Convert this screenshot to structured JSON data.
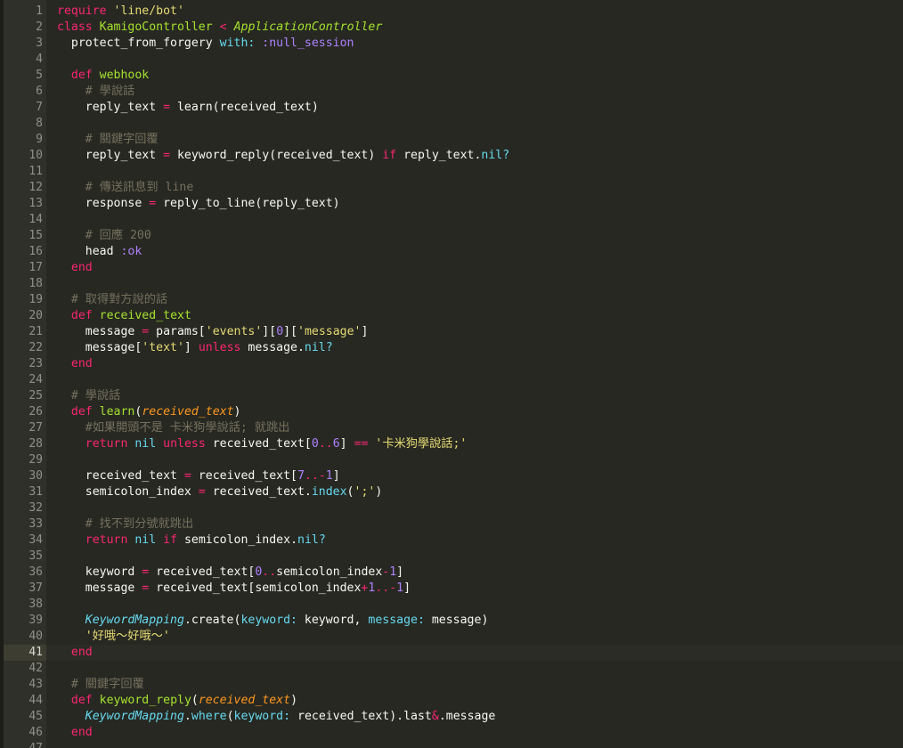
{
  "editor": {
    "active_line": 41,
    "line_numbers": [
      1,
      2,
      3,
      4,
      5,
      6,
      7,
      8,
      9,
      10,
      11,
      12,
      13,
      14,
      15,
      16,
      17,
      18,
      19,
      20,
      21,
      22,
      23,
      24,
      25,
      26,
      27,
      28,
      29,
      30,
      31,
      32,
      33,
      34,
      35,
      36,
      37,
      38,
      39,
      40,
      41,
      42,
      43,
      44,
      45,
      46,
      47
    ],
    "lines": [
      [
        [
          "k",
          "require"
        ],
        [
          "t",
          " "
        ],
        [
          "s",
          "'line/bot'"
        ]
      ],
      [
        [
          "k",
          "class"
        ],
        [
          "t",
          " "
        ],
        [
          "f",
          "KamigoController"
        ],
        [
          "t",
          " "
        ],
        [
          "o",
          "<"
        ],
        [
          "t",
          " "
        ],
        [
          "g",
          "ApplicationController"
        ]
      ],
      [
        [
          "t",
          "  protect_from_forgery "
        ],
        [
          "b",
          "with:"
        ],
        [
          "t",
          " "
        ],
        [
          "y",
          ":null_session"
        ]
      ],
      [],
      [
        [
          "t",
          "  "
        ],
        [
          "k",
          "def"
        ],
        [
          "t",
          " "
        ],
        [
          "f",
          "webhook"
        ]
      ],
      [
        [
          "c",
          "    # 學說話"
        ]
      ],
      [
        [
          "t",
          "    reply_text "
        ],
        [
          "o",
          "="
        ],
        [
          "t",
          " learn(received_text)"
        ]
      ],
      [],
      [
        [
          "c",
          "    # 關鍵字回覆"
        ]
      ],
      [
        [
          "t",
          "    reply_text "
        ],
        [
          "o",
          "="
        ],
        [
          "t",
          " keyword_reply(received_text) "
        ],
        [
          "k",
          "if"
        ],
        [
          "t",
          " reply_text."
        ],
        [
          "b",
          "nil?"
        ]
      ],
      [],
      [
        [
          "c",
          "    # 傳送訊息到 line"
        ]
      ],
      [
        [
          "t",
          "    response "
        ],
        [
          "o",
          "="
        ],
        [
          "t",
          " reply_to_line(reply_text)"
        ]
      ],
      [],
      [
        [
          "c",
          "    # 回應 200"
        ]
      ],
      [
        [
          "t",
          "    head "
        ],
        [
          "y",
          ":ok"
        ]
      ],
      [
        [
          "t",
          "  "
        ],
        [
          "k",
          "end"
        ]
      ],
      [],
      [
        [
          "c",
          "  # 取得對方說的話"
        ]
      ],
      [
        [
          "t",
          "  "
        ],
        [
          "k",
          "def"
        ],
        [
          "t",
          " "
        ],
        [
          "f",
          "received_text"
        ]
      ],
      [
        [
          "t",
          "    message "
        ],
        [
          "o",
          "="
        ],
        [
          "t",
          " params["
        ],
        [
          "s",
          "'events'"
        ],
        [
          "t",
          "]["
        ],
        [
          "n",
          "0"
        ],
        [
          "t",
          "]["
        ],
        [
          "s",
          "'message'"
        ],
        [
          "t",
          "]"
        ]
      ],
      [
        [
          "t",
          "    message["
        ],
        [
          "s",
          "'text'"
        ],
        [
          "t",
          "] "
        ],
        [
          "k",
          "unless"
        ],
        [
          "t",
          " message."
        ],
        [
          "b",
          "nil?"
        ]
      ],
      [
        [
          "t",
          "  "
        ],
        [
          "k",
          "end"
        ]
      ],
      [],
      [
        [
          "c",
          "  # 學說話"
        ]
      ],
      [
        [
          "t",
          "  "
        ],
        [
          "k",
          "def"
        ],
        [
          "t",
          " "
        ],
        [
          "f",
          "learn"
        ],
        [
          "t",
          "("
        ],
        [
          "p",
          "received_text"
        ],
        [
          "t",
          ")"
        ]
      ],
      [
        [
          "c",
          "    #如果開頭不是 卡米狗學說話; 就跳出"
        ]
      ],
      [
        [
          "t",
          "    "
        ],
        [
          "k",
          "return"
        ],
        [
          "t",
          " "
        ],
        [
          "b",
          "nil"
        ],
        [
          "t",
          " "
        ],
        [
          "k",
          "unless"
        ],
        [
          "t",
          " received_text["
        ],
        [
          "n",
          "0"
        ],
        [
          "o",
          ".."
        ],
        [
          "n",
          "6"
        ],
        [
          "t",
          "] "
        ],
        [
          "o",
          "=="
        ],
        [
          "t",
          " "
        ],
        [
          "s",
          "'卡米狗學說話;'"
        ]
      ],
      [],
      [
        [
          "t",
          "    received_text "
        ],
        [
          "o",
          "="
        ],
        [
          "t",
          " received_text["
        ],
        [
          "n",
          "7"
        ],
        [
          "o",
          ".."
        ],
        [
          "o",
          "-"
        ],
        [
          "n",
          "1"
        ],
        [
          "t",
          "]"
        ]
      ],
      [
        [
          "t",
          "    semicolon_index "
        ],
        [
          "o",
          "="
        ],
        [
          "t",
          " received_text."
        ],
        [
          "b",
          "index"
        ],
        [
          "t",
          "("
        ],
        [
          "s",
          "';'"
        ],
        [
          "t",
          ")"
        ]
      ],
      [],
      [
        [
          "c",
          "    # 找不到分號就跳出"
        ]
      ],
      [
        [
          "t",
          "    "
        ],
        [
          "k",
          "return"
        ],
        [
          "t",
          " "
        ],
        [
          "b",
          "nil"
        ],
        [
          "t",
          " "
        ],
        [
          "k",
          "if"
        ],
        [
          "t",
          " semicolon_index."
        ],
        [
          "b",
          "nil?"
        ]
      ],
      [],
      [
        [
          "t",
          "    keyword "
        ],
        [
          "o",
          "="
        ],
        [
          "t",
          " received_text["
        ],
        [
          "n",
          "0"
        ],
        [
          "o",
          ".."
        ],
        [
          "t",
          "semicolon_index"
        ],
        [
          "o",
          "-"
        ],
        [
          "n",
          "1"
        ],
        [
          "t",
          "]"
        ]
      ],
      [
        [
          "t",
          "    message "
        ],
        [
          "o",
          "="
        ],
        [
          "t",
          " received_text[semicolon_index"
        ],
        [
          "o",
          "+"
        ],
        [
          "n",
          "1"
        ],
        [
          "o",
          ".."
        ],
        [
          "o",
          "-"
        ],
        [
          "n",
          "1"
        ],
        [
          "t",
          "]"
        ]
      ],
      [],
      [
        [
          "t",
          "    "
        ],
        [
          "i",
          "KeywordMapping"
        ],
        [
          "t",
          ".create("
        ],
        [
          "b",
          "keyword:"
        ],
        [
          "t",
          " keyword, "
        ],
        [
          "b",
          "message:"
        ],
        [
          "t",
          " message)"
        ]
      ],
      [
        [
          "t",
          "    "
        ],
        [
          "s",
          "'好哦～好哦～'"
        ]
      ],
      [
        [
          "t",
          "  "
        ],
        [
          "k",
          "end"
        ]
      ],
      [],
      [
        [
          "c",
          "  # 關鍵字回覆"
        ]
      ],
      [
        [
          "t",
          "  "
        ],
        [
          "k",
          "def"
        ],
        [
          "t",
          " "
        ],
        [
          "f",
          "keyword_reply"
        ],
        [
          "t",
          "("
        ],
        [
          "p",
          "received_text"
        ],
        [
          "t",
          ")"
        ]
      ],
      [
        [
          "t",
          "    "
        ],
        [
          "i",
          "KeywordMapping"
        ],
        [
          "t",
          "."
        ],
        [
          "b",
          "where"
        ],
        [
          "t",
          "("
        ],
        [
          "b",
          "keyword:"
        ],
        [
          "t",
          " received_text).last"
        ],
        [
          "o",
          "&"
        ],
        [
          "t",
          ".message"
        ]
      ],
      [
        [
          "t",
          "  "
        ],
        [
          "k",
          "end"
        ]
      ],
      []
    ]
  }
}
